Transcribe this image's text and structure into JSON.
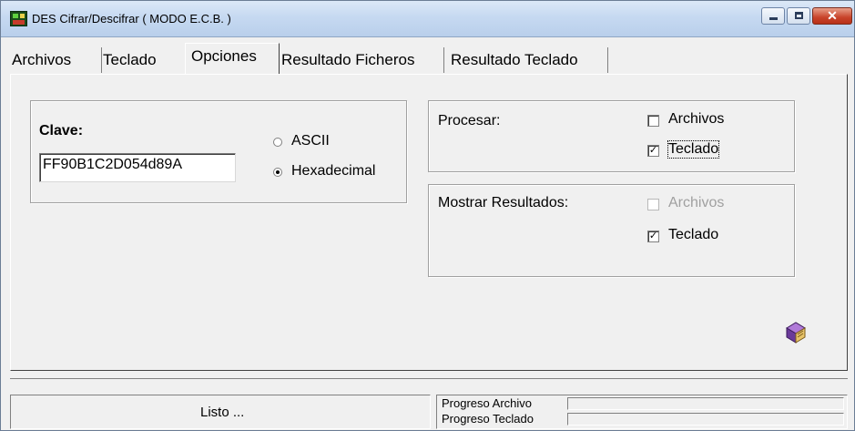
{
  "window": {
    "title": "DES Cifrar/Descifrar ( MODO E.C.B. )",
    "buttons": {
      "minimize": "–",
      "maximize": "□",
      "close": "✕"
    }
  },
  "tabs": [
    {
      "label": "Archivos"
    },
    {
      "label": "Teclado"
    },
    {
      "label": "Opciones",
      "active": true
    },
    {
      "label": "Resultado Ficheros"
    },
    {
      "label": "Resultado Teclado"
    }
  ],
  "clave": {
    "label": "Clave:",
    "value": "FF90B1C2D054d89A",
    "format_options": [
      {
        "label": "ASCII",
        "selected": false
      },
      {
        "label": "Hexadecimal",
        "selected": true
      }
    ]
  },
  "procesar": {
    "label": "Procesar:",
    "options": [
      {
        "label": "Archivos",
        "checked": false,
        "enabled": true
      },
      {
        "label": "Teclado",
        "checked": true,
        "enabled": true,
        "focused": true
      }
    ]
  },
  "mostrar_resultados": {
    "label": "Mostrar Resultados:",
    "options": [
      {
        "label": "Archivos",
        "checked": false,
        "enabled": false
      },
      {
        "label": "Teclado",
        "checked": true,
        "enabled": true
      }
    ]
  },
  "icons": {
    "help_book": "book-icon"
  },
  "statusbar": {
    "status_text": "Listo ...",
    "progreso_archivo_label": "Progreso Archivo",
    "progreso_teclado_label": "Progreso Teclado",
    "progreso_archivo_value": 0,
    "progreso_teclado_value": 0
  },
  "colors": {
    "title_gradient": "#c6d9f1",
    "close_button": "#c8432a",
    "face": "#f0f0f0"
  }
}
